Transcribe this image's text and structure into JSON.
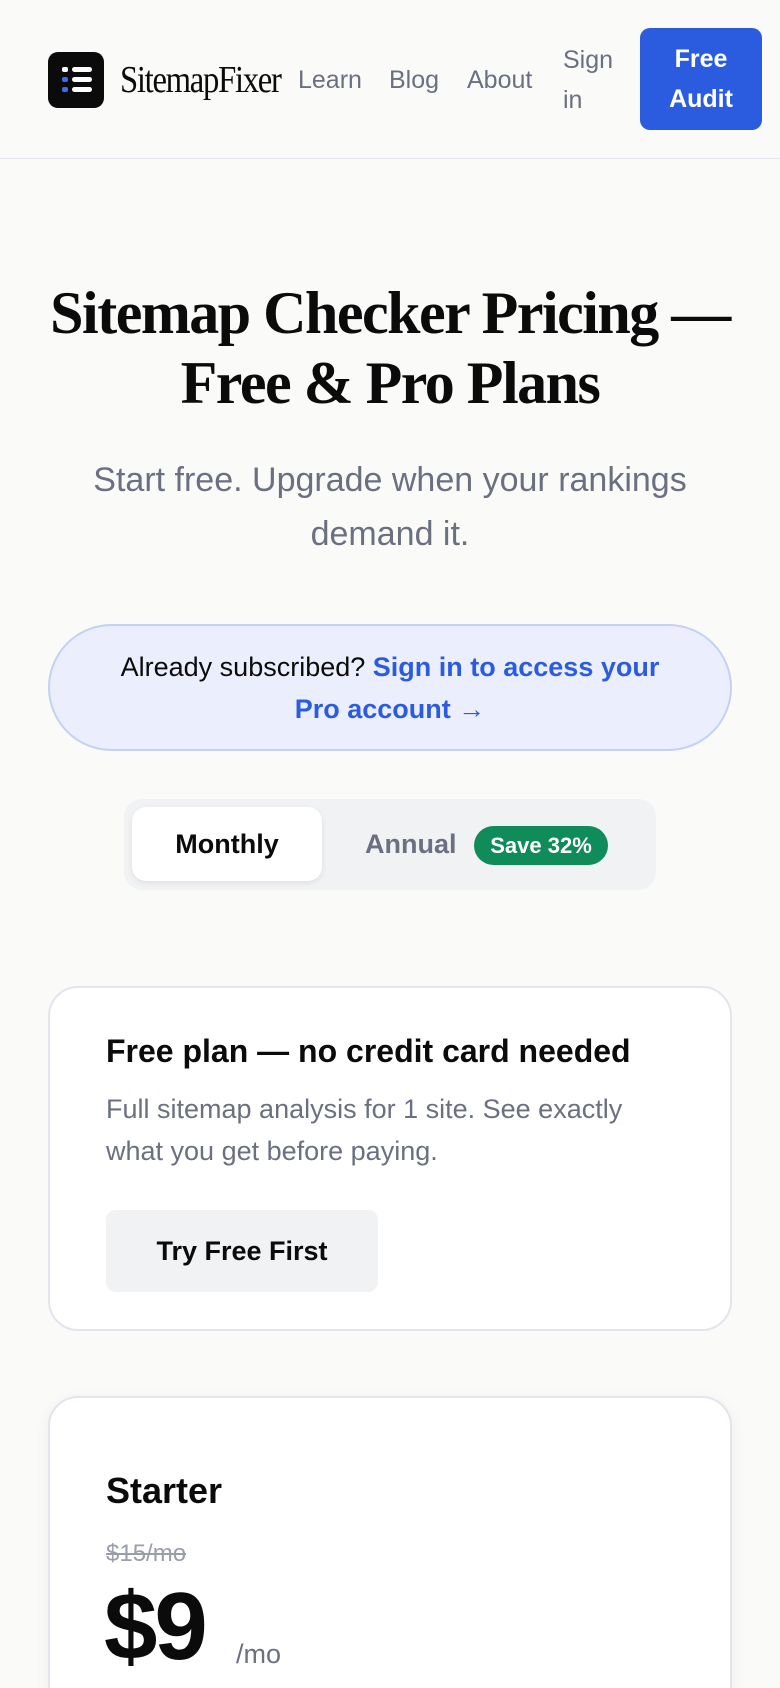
{
  "header": {
    "brand": "SitemapFixer",
    "logo_icon": "list-icon",
    "nav": [
      {
        "label": "Learn"
      },
      {
        "label": "Blog"
      },
      {
        "label": "About"
      }
    ],
    "signin_line1": "Sign",
    "signin_line2": "in",
    "cta_line1": "Free",
    "cta_line2": "Audit",
    "accent_color": "#2b5ce0"
  },
  "hero": {
    "title_line1": "Sitemap Checker Pricing —",
    "title_line2": "Free & Pro Plans",
    "subtitle_line1": "Start free. Upgrade when your rankings",
    "subtitle_line2": "demand it."
  },
  "banner": {
    "text": "Already subscribed? ",
    "link": "Sign in to access your Pro account →"
  },
  "billing": {
    "monthly": "Monthly",
    "annual": "Annual",
    "save_badge": "Save 32%",
    "selected": "Monthly",
    "badge_color": "#0f8c5a"
  },
  "free_plan": {
    "title": "Free plan — no credit card needed",
    "description": "Full sitemap analysis for 1 site. See exactly what you get before paying.",
    "button": "Try Free First"
  },
  "starter_plan": {
    "name": "Starter",
    "old_price": "$15/mo",
    "price": "$9",
    "period": "/mo"
  }
}
